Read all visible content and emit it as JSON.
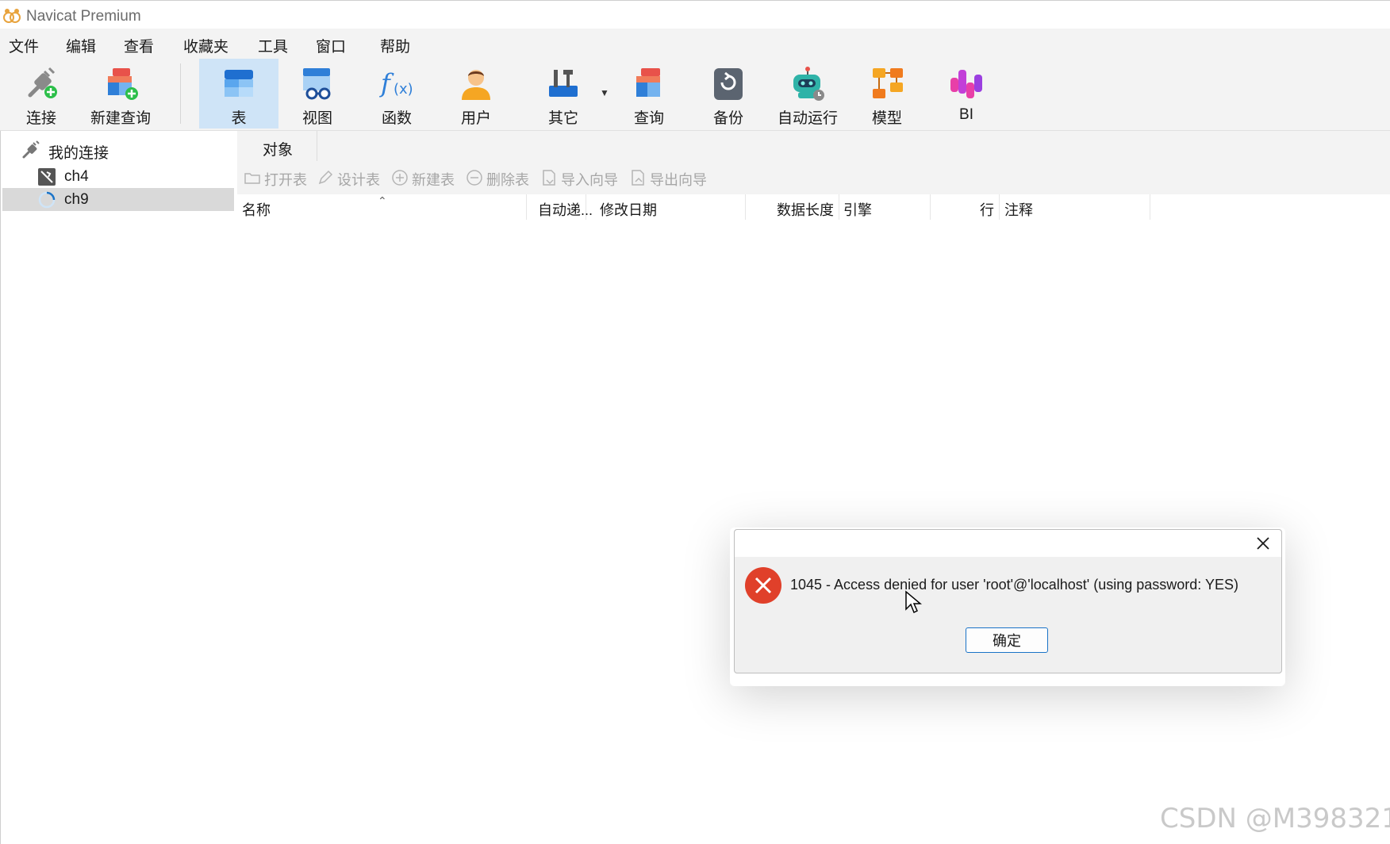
{
  "window": {
    "title": "Navicat Premium"
  },
  "menu": [
    "文件",
    "编辑",
    "查看",
    "收藏夹",
    "工具",
    "窗口",
    "帮助"
  ],
  "toolbar": {
    "connect": "连接",
    "new_query": "新建查询",
    "table": "表",
    "view": "视图",
    "function": "函数",
    "user": "用户",
    "other": "其它",
    "query": "查询",
    "backup": "备份",
    "automation": "自动运行",
    "model": "模型",
    "bi": "BI"
  },
  "sidebar": {
    "root": "我的连接",
    "items": [
      {
        "label": "ch4",
        "icon": "connection-offline-icon",
        "selected": false
      },
      {
        "label": "ch9",
        "icon": "loading-spinner-icon",
        "selected": true
      }
    ]
  },
  "tabs": [
    "对象"
  ],
  "object_toolbar": {
    "open_table": "打开表",
    "design_table": "设计表",
    "new_table": "新建表",
    "delete_table": "删除表",
    "import_wizard": "导入向导",
    "export_wizard": "导出向导"
  },
  "table": {
    "columns": [
      "名称",
      "自动递...",
      "修改日期",
      "数据长度",
      "引擎",
      "行",
      "注释"
    ],
    "rows": []
  },
  "dialog": {
    "message": "1045 - Access denied for user 'root'@'localhost' (using password: YES)",
    "ok_label": "确定"
  },
  "watermark": "CSDN @M398321",
  "colors": {
    "accent": "#1a73c7",
    "error": "#e0402a",
    "selected_bg": "#cfe4f7"
  }
}
